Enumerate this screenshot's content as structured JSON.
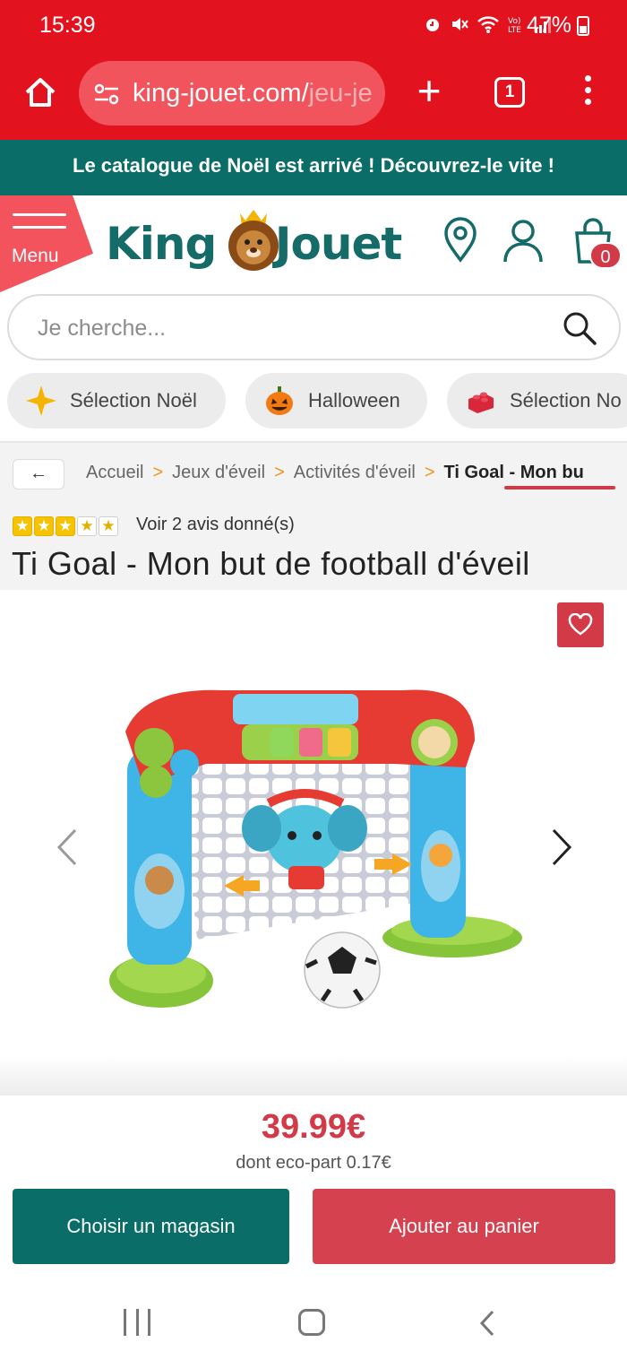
{
  "status_bar": {
    "time": "15:39",
    "battery": "47%",
    "icons": [
      "alarm-icon",
      "mute-icon",
      "wifi-icon",
      "volte-icon",
      "signal-icon",
      "battery-icon"
    ]
  },
  "browser": {
    "url_visible": "king-jouet.com/",
    "url_faded": "jeu-je",
    "tab_count": "1"
  },
  "promo": {
    "text": "Le catalogue de Noël est arrivé ! Découvrez-le vite !"
  },
  "header": {
    "menu_label": "Menu",
    "logo_text": "KingJouet",
    "cart_count": "0"
  },
  "search": {
    "placeholder": "Je cherche..."
  },
  "chips": [
    {
      "label": "Sélection Noël",
      "icon": "sparkle-icon"
    },
    {
      "label": "Halloween",
      "icon": "pumpkin-icon"
    },
    {
      "label": "Sélection No",
      "icon": "brick-icon"
    }
  ],
  "breadcrumb": {
    "back": "←",
    "items": [
      "Accueil",
      "Jeux d'éveil",
      "Activités d'éveil",
      "Ti Goal - Mon bu"
    ]
  },
  "product": {
    "rating_stars": 3,
    "rating_max": 5,
    "reviews_text": "Voir 2 avis donné(s)",
    "title": "Ti Goal - Mon but de football d'éveil",
    "price": "39.99€",
    "eco_part": "dont eco-part 0.17€"
  },
  "actions": {
    "store_button": "Choisir un magasin",
    "cart_button": "Ajouter au panier"
  },
  "colors": {
    "browser_red": "#e3121f",
    "brand_teal": "#0a6d68",
    "accent_red": "#d33a48"
  }
}
